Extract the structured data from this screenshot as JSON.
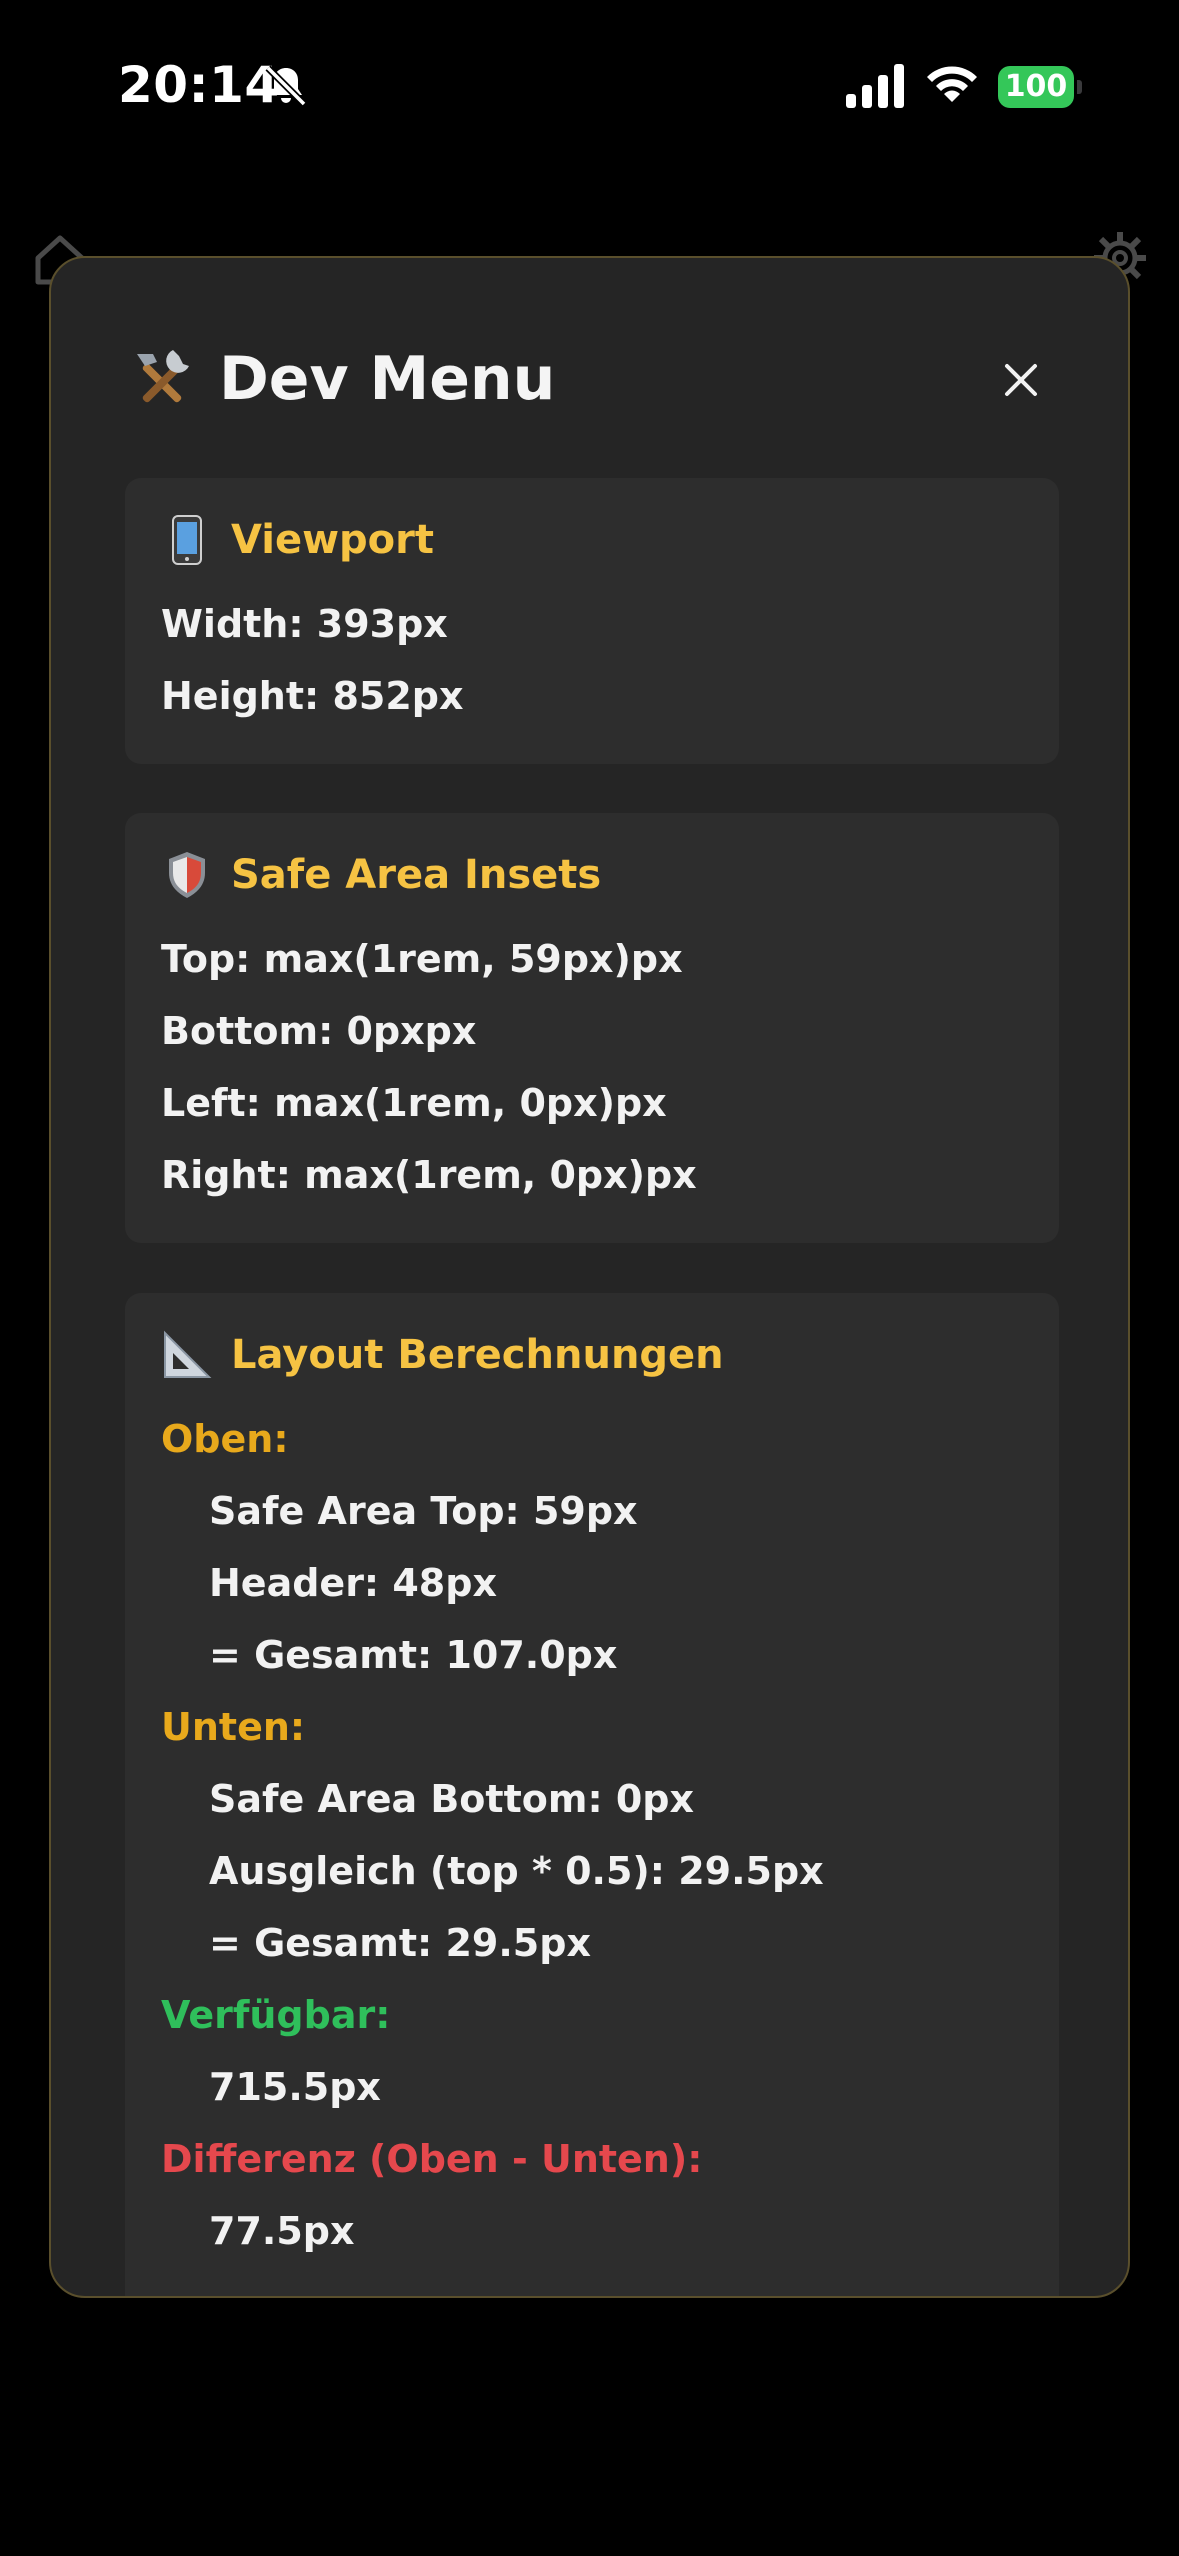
{
  "status_bar": {
    "time": "20:14",
    "battery": "100"
  },
  "modal": {
    "title": "Dev Menu",
    "close_label": "×"
  },
  "viewport": {
    "title": "Viewport",
    "width": "Width: 393px",
    "height": "Height: 852px"
  },
  "safe_area": {
    "title": "Safe Area Insets",
    "top": "Top: max(1rem, 59px)px",
    "bottom": "Bottom: 0pxpx",
    "left": "Left: max(1rem, 0px)px",
    "right": "Right: max(1rem, 0px)px"
  },
  "layout": {
    "title": "Layout Berechnungen",
    "oben_label": "Oben:",
    "oben_lines": [
      "Safe Area Top: 59px",
      "Header: 48px",
      "= Gesamt: 107.0px"
    ],
    "unten_label": "Unten:",
    "unten_lines": [
      "Safe Area Bottom: 0px",
      "Ausgleich (top * 0.5): 29.5px",
      "= Gesamt: 29.5px"
    ],
    "verfuegbar_label": "Verfügbar:",
    "verfuegbar_value": "715.5px",
    "differenz_label": "Differenz (Oben - Unten):",
    "differenz_value": "77.5px"
  },
  "colors": {
    "accent_title": "#f6c343",
    "label_orange": "#e8a91c",
    "label_green": "#2fbf5b",
    "label_red": "#e5484d",
    "battery_green": "#34c759"
  },
  "icons": [
    "bell-slash-icon",
    "cellular-signal-icon",
    "wifi-icon",
    "battery-icon",
    "home-icon",
    "gear-icon",
    "tools-icon",
    "close-icon",
    "phone-icon",
    "shield-icon",
    "triangle-ruler-icon"
  ]
}
